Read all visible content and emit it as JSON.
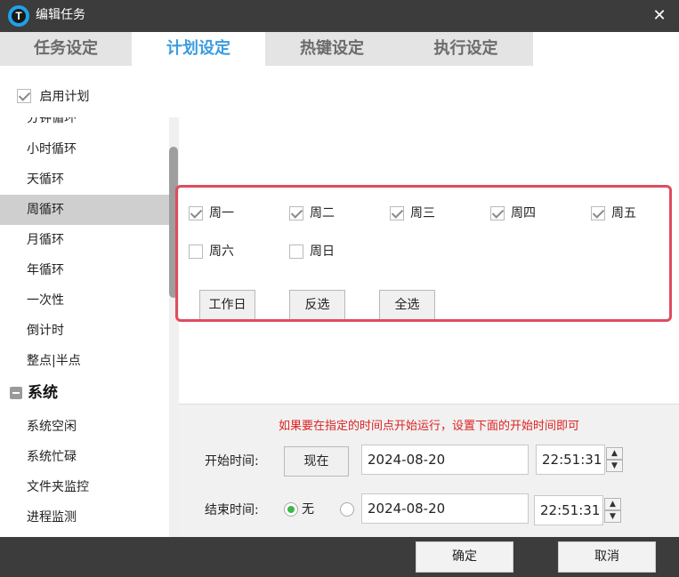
{
  "window": {
    "title": "编辑任务",
    "app_icon_letter": "T",
    "close_glyph": "✕"
  },
  "tabs": [
    {
      "label": "任务设定",
      "active": false
    },
    {
      "label": "计划设定",
      "active": true
    },
    {
      "label": "热键设定",
      "active": false
    },
    {
      "label": "执行设定",
      "active": false
    }
  ],
  "enable_plan": {
    "label": "启用计划",
    "checked": true
  },
  "sidebar": {
    "items": [
      {
        "label": "分钟循环",
        "selected": false
      },
      {
        "label": "小时循环",
        "selected": false
      },
      {
        "label": "天循环",
        "selected": false
      },
      {
        "label": "周循环",
        "selected": true
      },
      {
        "label": "月循环",
        "selected": false
      },
      {
        "label": "年循环",
        "selected": false
      },
      {
        "label": "一次性",
        "selected": false
      },
      {
        "label": "倒计时",
        "selected": false
      },
      {
        "label": "整点|半点",
        "selected": false
      }
    ],
    "group": {
      "label": "系统"
    },
    "group_items": [
      {
        "label": "系统空闲"
      },
      {
        "label": "系统忙碌"
      },
      {
        "label": "文件夹监控"
      },
      {
        "label": "进程监测"
      }
    ]
  },
  "weekdays": [
    {
      "label": "周一",
      "checked": true
    },
    {
      "label": "周二",
      "checked": true
    },
    {
      "label": "周三",
      "checked": true
    },
    {
      "label": "周四",
      "checked": true
    },
    {
      "label": "周五",
      "checked": true
    },
    {
      "label": "周六",
      "checked": false
    },
    {
      "label": "周日",
      "checked": false
    }
  ],
  "day_buttons": {
    "workday": "工作日",
    "invert": "反选",
    "select_all": "全选"
  },
  "hint": "如果要在指定的时间点开始运行，设置下面的开始时间即可",
  "start": {
    "label": "开始时间:",
    "now_button": "现在",
    "date": "2024-08-20",
    "time": "22:51:31"
  },
  "end": {
    "label": "结束时间:",
    "none_label": "无",
    "none_selected": true,
    "date": "2024-08-20",
    "time": "22:51:31"
  },
  "spin_up": "▲",
  "spin_down": "▼",
  "footer": {
    "ok": "确定",
    "cancel": "取消"
  },
  "colors": {
    "accent": "#3a9ce0",
    "highlight": "#e04b5f",
    "hint": "#dd2222",
    "titlebar": "#3c3c3c",
    "radio_on": "#3bb84a"
  }
}
